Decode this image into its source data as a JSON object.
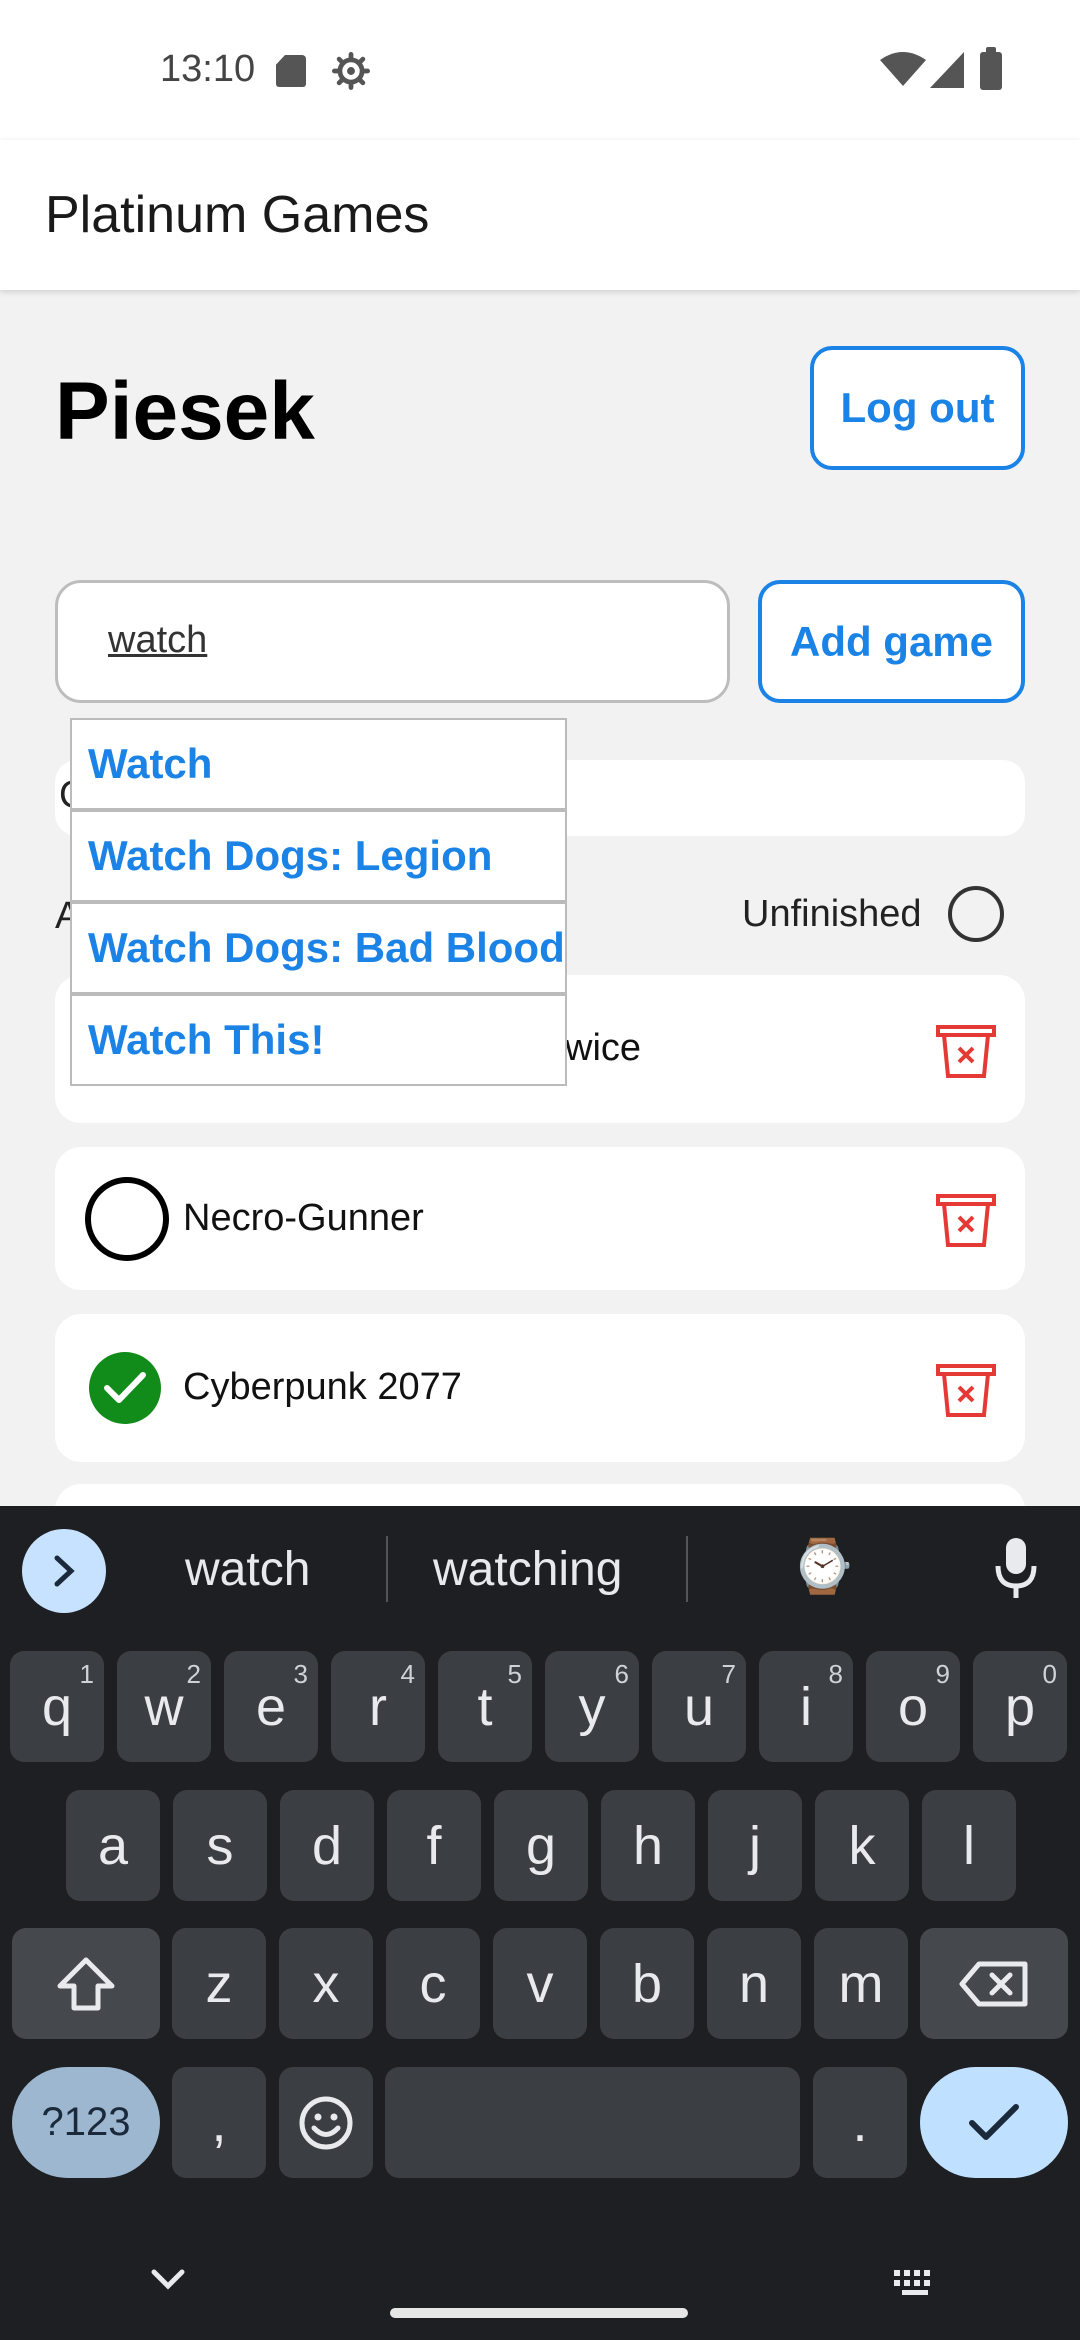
{
  "status_bar": {
    "time": "13:10"
  },
  "app_bar": {
    "title": "Platinum Games"
  },
  "header": {
    "username": "Piesek",
    "logout_label": "Log out"
  },
  "search": {
    "value": "watch",
    "add_label": "Add game"
  },
  "filters": {
    "lead_letter": "C",
    "row_lead": "A",
    "row_paren": ")",
    "unfinished_label": "Unfinished"
  },
  "autocomplete": [
    {
      "label": "Watch"
    },
    {
      "label": "Watch Dogs: Legion"
    },
    {
      "label": "Watch Dogs: Bad Blood"
    },
    {
      "label": "Watch This!"
    }
  ],
  "games": [
    {
      "label_visible": "wice",
      "finished": null
    },
    {
      "label": "Necro-Gunner",
      "finished": false
    },
    {
      "label": "Cyberpunk 2077",
      "finished": true
    }
  ],
  "keyboard": {
    "suggestions": [
      "watch",
      "watching"
    ],
    "suggestion_emoji": "⌚",
    "row1": [
      {
        "k": "q",
        "n": "1"
      },
      {
        "k": "w",
        "n": "2"
      },
      {
        "k": "e",
        "n": "3"
      },
      {
        "k": "r",
        "n": "4"
      },
      {
        "k": "t",
        "n": "5"
      },
      {
        "k": "y",
        "n": "6"
      },
      {
        "k": "u",
        "n": "7"
      },
      {
        "k": "i",
        "n": "8"
      },
      {
        "k": "o",
        "n": "9"
      },
      {
        "k": "p",
        "n": "0"
      }
    ],
    "row2": [
      "a",
      "s",
      "d",
      "f",
      "g",
      "h",
      "j",
      "k",
      "l"
    ],
    "row3": [
      "z",
      "x",
      "c",
      "v",
      "b",
      "n",
      "m"
    ],
    "sym_label": "?123",
    "comma_label": ",",
    "period_label": "."
  },
  "colors": {
    "accent": "#1b82e6",
    "delete": "#e53935",
    "done": "#118c1a"
  }
}
